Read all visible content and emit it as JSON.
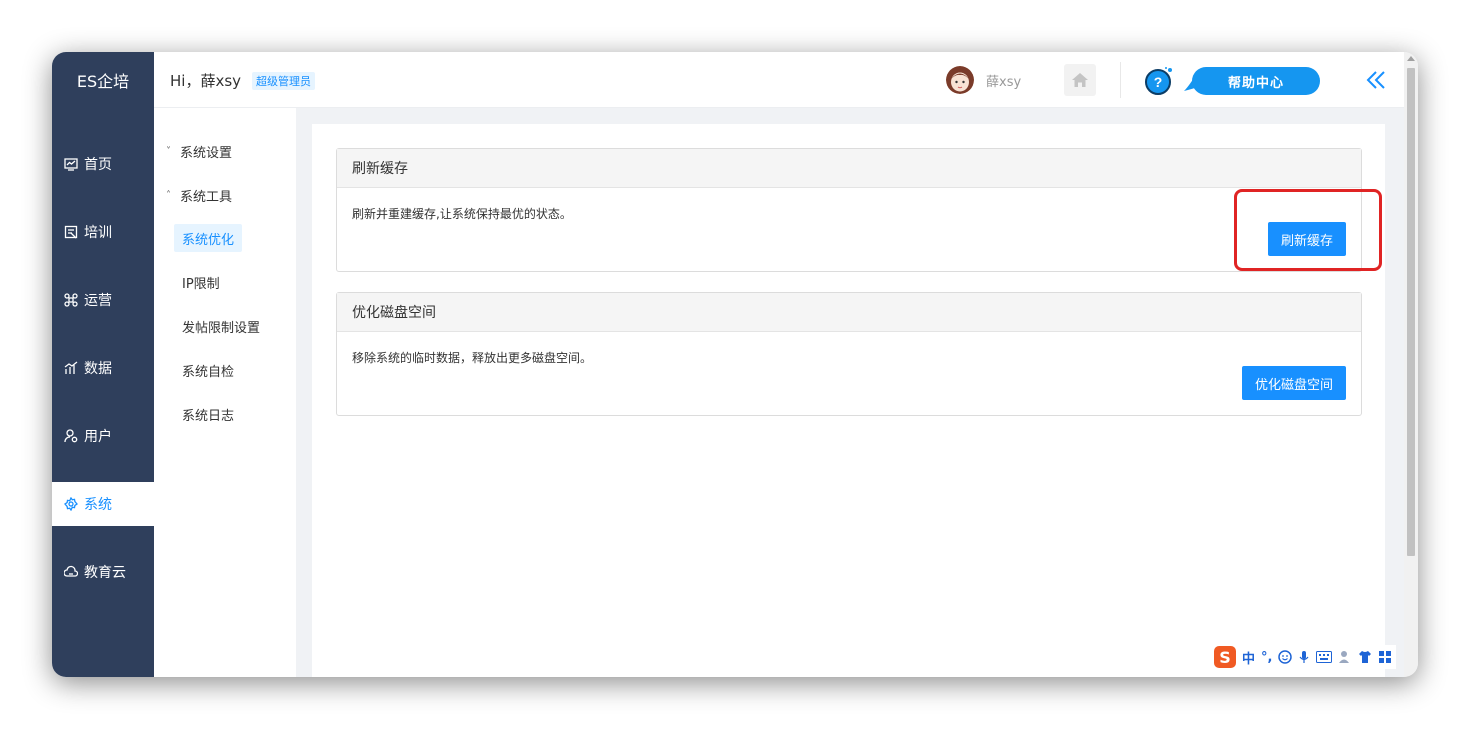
{
  "brand": {
    "title": "ES企培"
  },
  "sidebar": {
    "items": [
      {
        "label": "首页",
        "icon": "dashboard-icon"
      },
      {
        "label": "培训",
        "icon": "book-icon"
      },
      {
        "label": "运营",
        "icon": "command-icon"
      },
      {
        "label": "数据",
        "icon": "chart-icon"
      },
      {
        "label": "用户",
        "icon": "user-icon"
      },
      {
        "label": "系统",
        "icon": "gear-icon",
        "active": true
      },
      {
        "label": "教育云",
        "icon": "cloud-icon"
      }
    ]
  },
  "header": {
    "greeting": "Hi，薛xsy",
    "role": "超级管理员",
    "username": "薛xsy",
    "help_label": "帮助中心"
  },
  "subnav": {
    "groups": [
      {
        "label": "系统设置",
        "chevron": "˅"
      },
      {
        "label": "系统工具",
        "chevron": "˄"
      }
    ],
    "items": [
      {
        "label": "系统优化",
        "active": true
      },
      {
        "label": "IP限制"
      },
      {
        "label": "发帖限制设置"
      },
      {
        "label": "系统自检"
      },
      {
        "label": "系统日志"
      }
    ]
  },
  "cards": [
    {
      "title": "刷新缓存",
      "description": "刷新并重建缓存,让系统保持最优的状态。",
      "button": "刷新缓存"
    },
    {
      "title": "优化磁盘空间",
      "description": "移除系统的临时数据，释放出更多磁盘空间。",
      "button": "优化磁盘空间"
    }
  ],
  "ime": {
    "lang": "中",
    "punct": "°,"
  },
  "colors": {
    "sidebar": "#2f3f5c",
    "primary": "#1890ff",
    "highlight": "#e02424"
  }
}
